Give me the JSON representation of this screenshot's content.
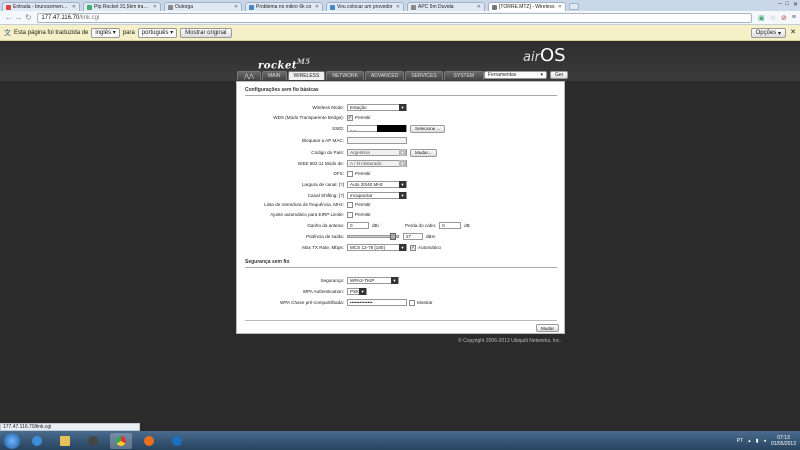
{
  "browser": {
    "tabs": [
      {
        "title": "Entrada - brunocemenyi@",
        "color": "#d44"
      },
      {
        "title": "Ptp Rocket 31,5km travan",
        "color": "#4a7"
      },
      {
        "title": "Outorga",
        "color": "#888"
      },
      {
        "title": "Problema no mikro 6k co",
        "color": "#48c"
      },
      {
        "title": "Vou colocar um provedor",
        "color": "#48c"
      },
      {
        "title": "APC 5m Duvida",
        "color": "#888"
      },
      {
        "title": "[TORRE.MTZ] - Wireless",
        "color": "#777",
        "active": true
      }
    ],
    "url_host": "177.47.116.70",
    "url_path": "/link.cgi",
    "translate_bar": {
      "prefix": "Esta página foi traduzida de",
      "from_lang": "inglês",
      "to_word": "para",
      "to_lang": "português",
      "show_original": "Mostrar original",
      "options": "Opções"
    },
    "status_url": "177.47.116.70/link.cgi"
  },
  "app": {
    "brand": "rocket",
    "brand_model": "M5",
    "os_air": "air",
    "os_name": "OS",
    "nav_tabs": [
      "MAIN",
      "WIRELESS",
      "NETWORK",
      "ADVANCED",
      "SERVICES",
      "SYSTEM"
    ],
    "active_tab": "WIRELESS",
    "tools_select": "Ferramentas",
    "tools_go": "Ger",
    "basic_section": "Configurações sem fio básicas",
    "fields": {
      "wireless_mode_label": "Wireless Mode:",
      "wireless_mode_value": "Estação",
      "wds_label": "WDS (Modo Transparente Bridge):",
      "wds_check_label": "Permitir",
      "ssid_label": "SSID:",
      "ssid_value": "_ _",
      "select_btn": "Selecione ...",
      "lock_ap_label": "Bloquear a AP MAC:",
      "country_label": "Código do País:",
      "country_value": "Argentina",
      "change_btn": "Mudar...",
      "ieee_label": "IEEE 802.11 Modo de:",
      "ieee_value": "A / N misturado",
      "dfs_label": "DFS:",
      "dfs_check_label": "Permitir",
      "width_label": "Largura de canal: [?]",
      "width_value": "Auto 20/40 MHz",
      "shift_label": "Canal Shifting: [?]",
      "shift_value": "Incapacitar",
      "scan_label": "Lista de Varredura de frequência, MHz:",
      "scan_check_label": "Permitir",
      "eirp_label": "Ajuste automático para EIRP Limite:",
      "eirp_check_label": "Permitir",
      "gain_label": "Ganho da antena:",
      "gain_value": "0",
      "gain_unit": "dBi",
      "loss_label": "Perda do cabo:",
      "loss_value": "0",
      "loss_unit": "dB",
      "power_label": "Potência de saída:",
      "power_value": "27",
      "power_unit": "dBm",
      "power_level": 0.95,
      "rate_label": "Max TX Rate, Mbps:",
      "rate_value": "MCS 12-78 [180]",
      "rate_auto": "Automático"
    },
    "security_section": "Segurança sem fio",
    "security": {
      "security_label": "Segurança:",
      "security_value": "WPA2-TKIP",
      "auth_label": "WPA Authentication:",
      "auth_value": "PSK",
      "key_label": "WPA Chave pré-compartilhada:",
      "key_value": "••••••••••••••",
      "show_label": "Mostrar"
    },
    "change_btn": "Mudar",
    "copyright": "© Copyright 2006-2012 Ubiquiti Networks, Inc."
  },
  "taskbar": {
    "lang": "PT",
    "time": "07:13",
    "date": "01/05/2013"
  }
}
